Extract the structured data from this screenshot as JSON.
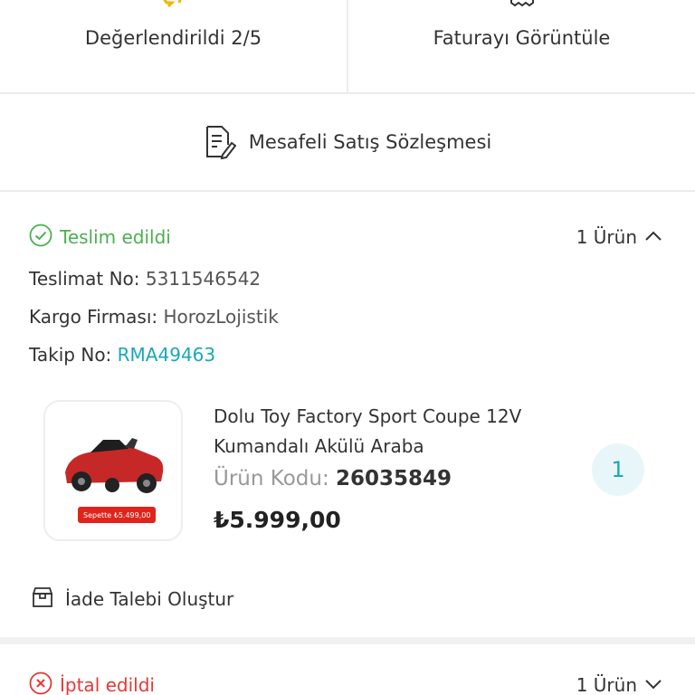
{
  "top_actions": {
    "rating_label": "Değerlendirildi 2/5",
    "invoice_label": "Faturayı Görüntüle"
  },
  "contract": {
    "label": "Mesafeli Satış Sözleşmesi"
  },
  "shipment": {
    "status": "Teslim edildi",
    "status_color": "#4caf50",
    "item_count": "1 Ürün",
    "delivery_no_label": "Teslimat No:",
    "delivery_no": "5311546542",
    "carrier_label": "Kargo Firması:",
    "carrier": "HorozLojistik",
    "tracking_label": "Takip No:",
    "tracking_no": "RMA49463",
    "product": {
      "name": "Dolu Toy Factory Sport Coupe 12V Kumandalı Akülü Araba",
      "code_label": "Ürün Kodu:",
      "code": "26035849",
      "price": "₺5.999,00",
      "quantity": "1",
      "image_tag": "Sepette ₺5.499,00"
    },
    "return_label": "İade Talebi Oluştur"
  },
  "next_shipment": {
    "status": "İptal edildi",
    "status_color": "#e53935",
    "item_count": "1 Ürün"
  },
  "accent_color": "#1aa7b8"
}
